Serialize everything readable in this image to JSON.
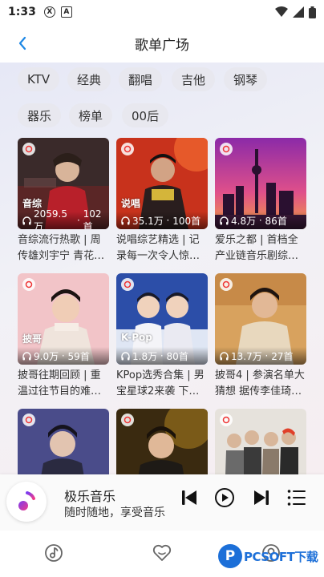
{
  "status_bar": {
    "time": "1:33",
    "icon1": "X",
    "icon2": "A"
  },
  "header": {
    "title": "歌单广场",
    "back_icon": "chevron-left-icon"
  },
  "tags": [
    {
      "label": "KTV"
    },
    {
      "label": "经典"
    },
    {
      "label": "翻唱"
    },
    {
      "label": "吉他"
    },
    {
      "label": "钢琴"
    },
    {
      "label": "器乐"
    },
    {
      "label": "榜单"
    },
    {
      "label": "00后"
    }
  ],
  "cards": [
    {
      "badge": "音综",
      "plays": "2059.5万",
      "tracks": "102首",
      "title": "音综流行热歌 | 周传雄刘宇宁 青花…"
    },
    {
      "badge": "说唱",
      "plays": "35.1万",
      "tracks": "100首",
      "title": "说唱综艺精选 | 记录每一次令人惊…"
    },
    {
      "badge": "",
      "plays": "4.8万",
      "tracks": "86首",
      "title": "爱乐之都 | 首档全产业链音乐剧综…"
    },
    {
      "badge": "披哥",
      "plays": "9.0万",
      "tracks": "59首",
      "title": "披哥往期回顾 | 重温过往节目的难…"
    },
    {
      "badge": "K-Pop",
      "plays": "1.8万",
      "tracks": "80首",
      "title": "KPop选秀合集 | 男宝星球2来袭 下…"
    },
    {
      "badge": "",
      "plays": "13.7万",
      "tracks": "27首",
      "title": "披哥4 | 参演名单大猜想 据传李佳琦…"
    },
    {
      "badge": "",
      "plays": "",
      "tracks": "",
      "title": ""
    },
    {
      "badge": "",
      "plays": "",
      "tracks": "",
      "title": ""
    },
    {
      "badge": "",
      "plays": "",
      "tracks": "",
      "title": ""
    }
  ],
  "player": {
    "name": "极乐音乐",
    "slogan": "随时随地，享受音乐",
    "prev_icon": "skip-previous-icon",
    "play_icon": "play-icon",
    "next_icon": "skip-next-icon",
    "list_icon": "playlist-icon"
  },
  "bottom_nav": [
    {
      "icon": "music-disc-icon"
    },
    {
      "icon": "heart-icon"
    },
    {
      "icon": "profile-icon"
    }
  ],
  "watermark": {
    "logo": "P",
    "text": "PCSOFT下载"
  },
  "colors": {
    "accent": "#1e88e5",
    "content_bg": "#eceef6",
    "tag_bg": "#e8e8ef"
  }
}
